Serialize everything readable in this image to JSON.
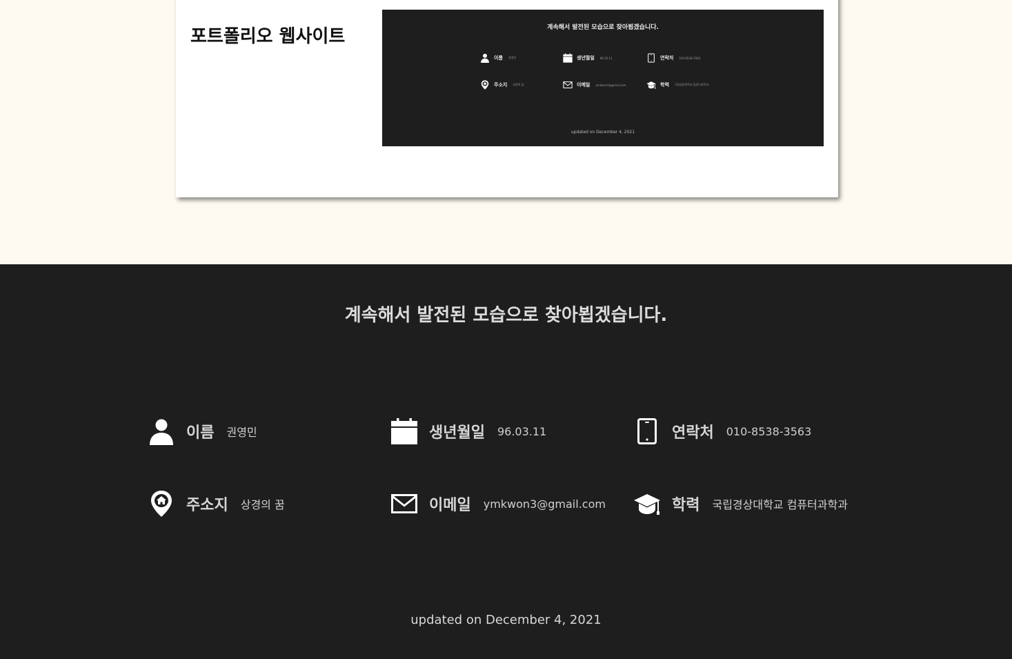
{
  "project": {
    "title": "포트폴리오 웹사이트"
  },
  "preview": {
    "heading": "계속해서 발전된 모습으로 찾아뵙겠습니다.",
    "items": [
      {
        "label": "이름",
        "value": "권영민"
      },
      {
        "label": "생년월일",
        "value": "96.03.11"
      },
      {
        "label": "연락처",
        "value": "010-8538-3563"
      },
      {
        "label": "주소지",
        "value": "상경의 꿈"
      },
      {
        "label": "이메일",
        "value": "ymkwon3@gmail.com"
      },
      {
        "label": "학력",
        "value": "국립경상대학교 컴퓨터과학과"
      }
    ],
    "updated": "updated on December 4, 2021"
  },
  "footer": {
    "heading": "계속해서 발전된 모습으로 찾아뵙겠습니다.",
    "items": [
      {
        "icon": "person-icon",
        "label": "이름",
        "value": "권영민"
      },
      {
        "icon": "calendar-icon",
        "label": "생년월일",
        "value": "96.03.11"
      },
      {
        "icon": "phone-icon",
        "label": "연락처",
        "value": "010-8538-3563"
      },
      {
        "icon": "location-pin-icon",
        "label": "주소지",
        "value": "상경의 꿈"
      },
      {
        "icon": "mail-icon",
        "label": "이메일",
        "value": "ymkwon3@gmail.com"
      },
      {
        "icon": "graduation-cap-icon",
        "label": "학력",
        "value": "국립경상대학교 컴퓨터과학과"
      }
    ],
    "updated": "updated on December 4, 2021"
  },
  "colors": {
    "page_background": "#fefaf2",
    "footer_background": "#1e1e1e",
    "text_light": "#d6d6d6"
  }
}
